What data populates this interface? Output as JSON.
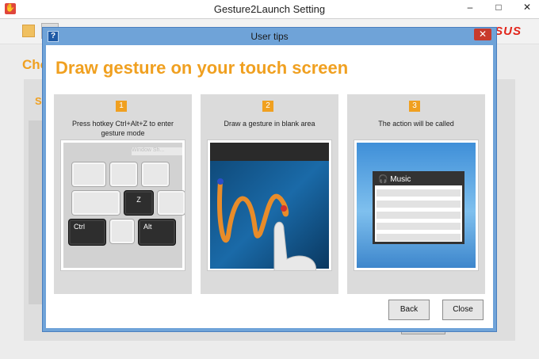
{
  "main_window": {
    "title": "Gesture2Launch Setting",
    "controls": {
      "minimize": "–",
      "maximize": "□",
      "close": "✕"
    },
    "heading": "Cho",
    "sub_heading": "S",
    "logo": "ASUS"
  },
  "dialog": {
    "title": "User tips",
    "help": "?",
    "close": "✕",
    "headline": "Draw gesture on your touch screen",
    "steps": [
      {
        "number": "1",
        "text": "Press hotkey Ctrl+Alt+Z to enter gesture mode"
      },
      {
        "number": "2",
        "text": "Draw a gesture in blank area"
      },
      {
        "number": "3",
        "text": "The action will be called"
      }
    ],
    "keyboard": {
      "key_z": "Z",
      "key_ctrl": "Ctrl",
      "key_alt": "Alt",
      "ghost_text": "Window Sh..."
    },
    "music_title": "Music",
    "buttons": {
      "back": "Back",
      "close": "Close"
    }
  },
  "colors": {
    "accent": "#f0a020",
    "dialog_frame": "#6fa3d8",
    "close_red": "#c83a2c"
  }
}
